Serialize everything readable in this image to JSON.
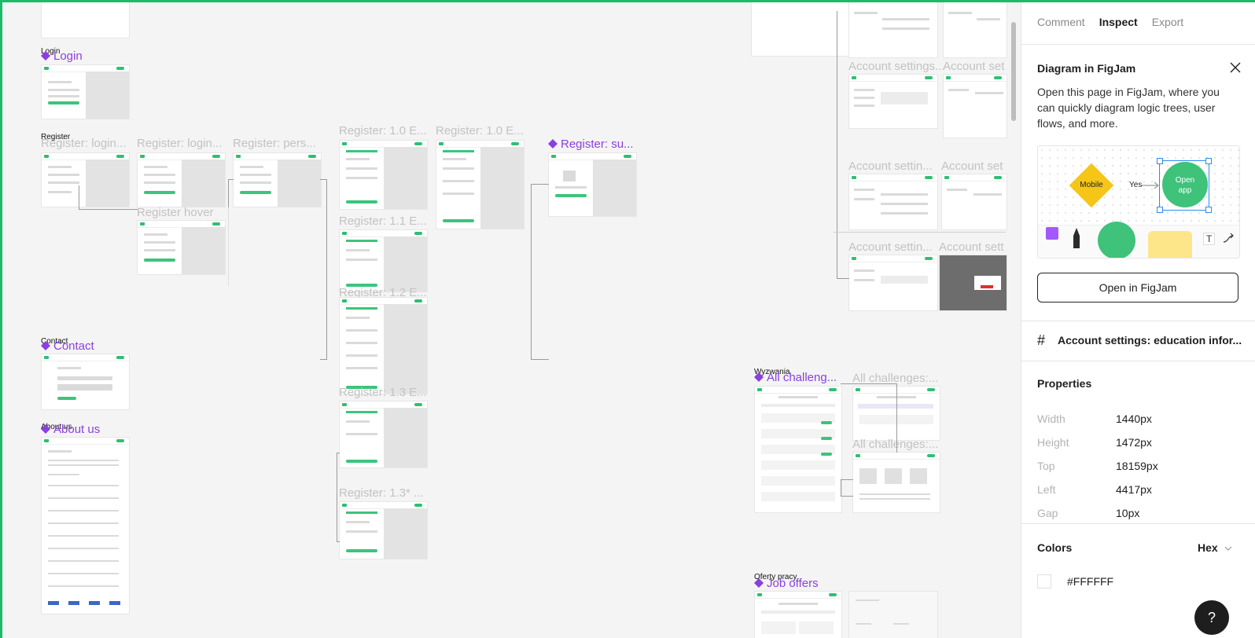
{
  "canvas": {
    "sections": {
      "login": {
        "tag": "Login",
        "title": "Login"
      },
      "register": {
        "tag": "Register"
      },
      "contact": {
        "tag": "Contact",
        "title": "Contact"
      },
      "about": {
        "tag": "About us",
        "title": "About us"
      },
      "wyzwania": {
        "tag": "Wyzwania",
        "title": "All challeng..."
      },
      "oferty": {
        "tag": "Oferty pracy",
        "title": "Job offers"
      }
    },
    "frame_titles": {
      "reg_login_1": "Register: login...",
      "reg_login_2": "Register: login...",
      "reg_pers": "Register: pers...",
      "reg_hover": "Register hover",
      "reg_10a": "Register: 1.0 E...",
      "reg_10b": "Register: 1.0 E...",
      "reg_11": "Register: 1.1 E...",
      "reg_12": "Register: 1.2 E...",
      "reg_13": "Register: 1.3 E...",
      "reg_13s": "Register: 1.3* ...",
      "reg_su": "Register: su...",
      "acc_1": "Account settings...",
      "acc_1b": "Account set",
      "acc_2": "Account settin...",
      "acc_2b": "Account set",
      "acc_3": "Account settin...",
      "acc_3b": "Account sett",
      "chal_1": "All challenges:...",
      "chal_2": "All challenges:..."
    }
  },
  "panel": {
    "tabs": [
      "Comment",
      "Inspect",
      "Export"
    ],
    "active_tab": "Inspect",
    "figjam": {
      "title": "Diagram in FigJam",
      "description": "Open this page in FigJam, where you can quickly diagram logic trees, user flows, and more.",
      "illustration": {
        "diamond_label": "Mobile",
        "arrow_label": "Yes",
        "circle_label": "Open app",
        "text_tool": "T"
      },
      "button_label": "Open in FigJam"
    },
    "frame_name": "Account settings: education infor...",
    "properties": {
      "heading": "Properties",
      "rows": [
        {
          "key": "Width",
          "value": "1440px"
        },
        {
          "key": "Height",
          "value": "1472px"
        },
        {
          "key": "Top",
          "value": "18159px"
        },
        {
          "key": "Left",
          "value": "4417px"
        },
        {
          "key": "Gap",
          "value": "10px"
        }
      ]
    },
    "colors": {
      "heading": "Colors",
      "format": "Hex",
      "swatch_value": "#FFFFFF"
    },
    "help_label": "?"
  },
  "theme": {
    "accent_green": "#1bbb6b",
    "component_purple": "#8b3fe0",
    "figjam_blue": "#2d8cf0"
  }
}
